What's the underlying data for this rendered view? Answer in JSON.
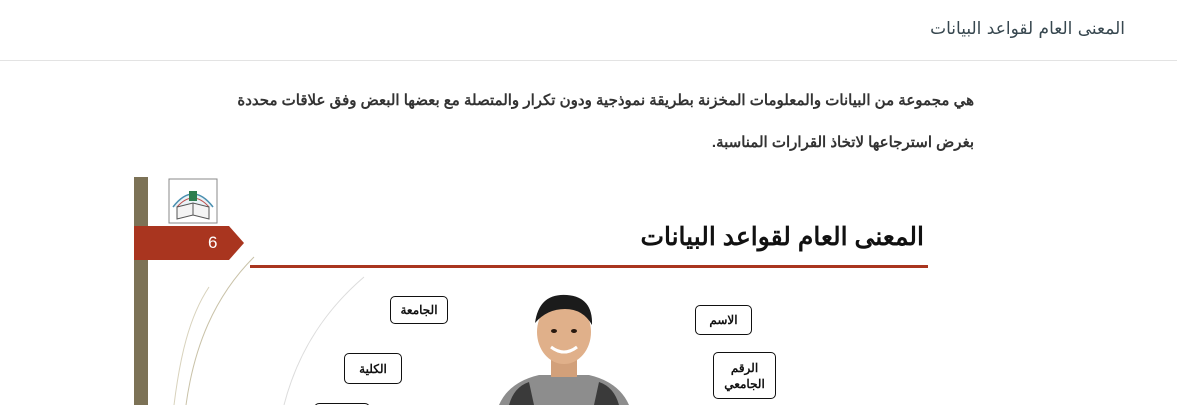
{
  "header": {
    "title": "المعنى العام لقواعد البيانات"
  },
  "intro": {
    "line1": "هي مجموعة من البيانات والمعلومات المخزنة بطريقة نموذجية ودون تكرار والمتصلة مع بعضها البعض وفق علاقات محددة",
    "line2": "بغرض استرجاعها لاتخاذ القرارات المناسبة."
  },
  "slide": {
    "number": "6",
    "title": "المعنى العام لقواعد البيانات",
    "boxes": {
      "university": "الجامعة",
      "college": "الكلية",
      "name": "الاسم",
      "student_id": "الرقم الجامعي"
    },
    "colors": {
      "accent": "#a9351f",
      "bar": "#7c7256"
    }
  }
}
